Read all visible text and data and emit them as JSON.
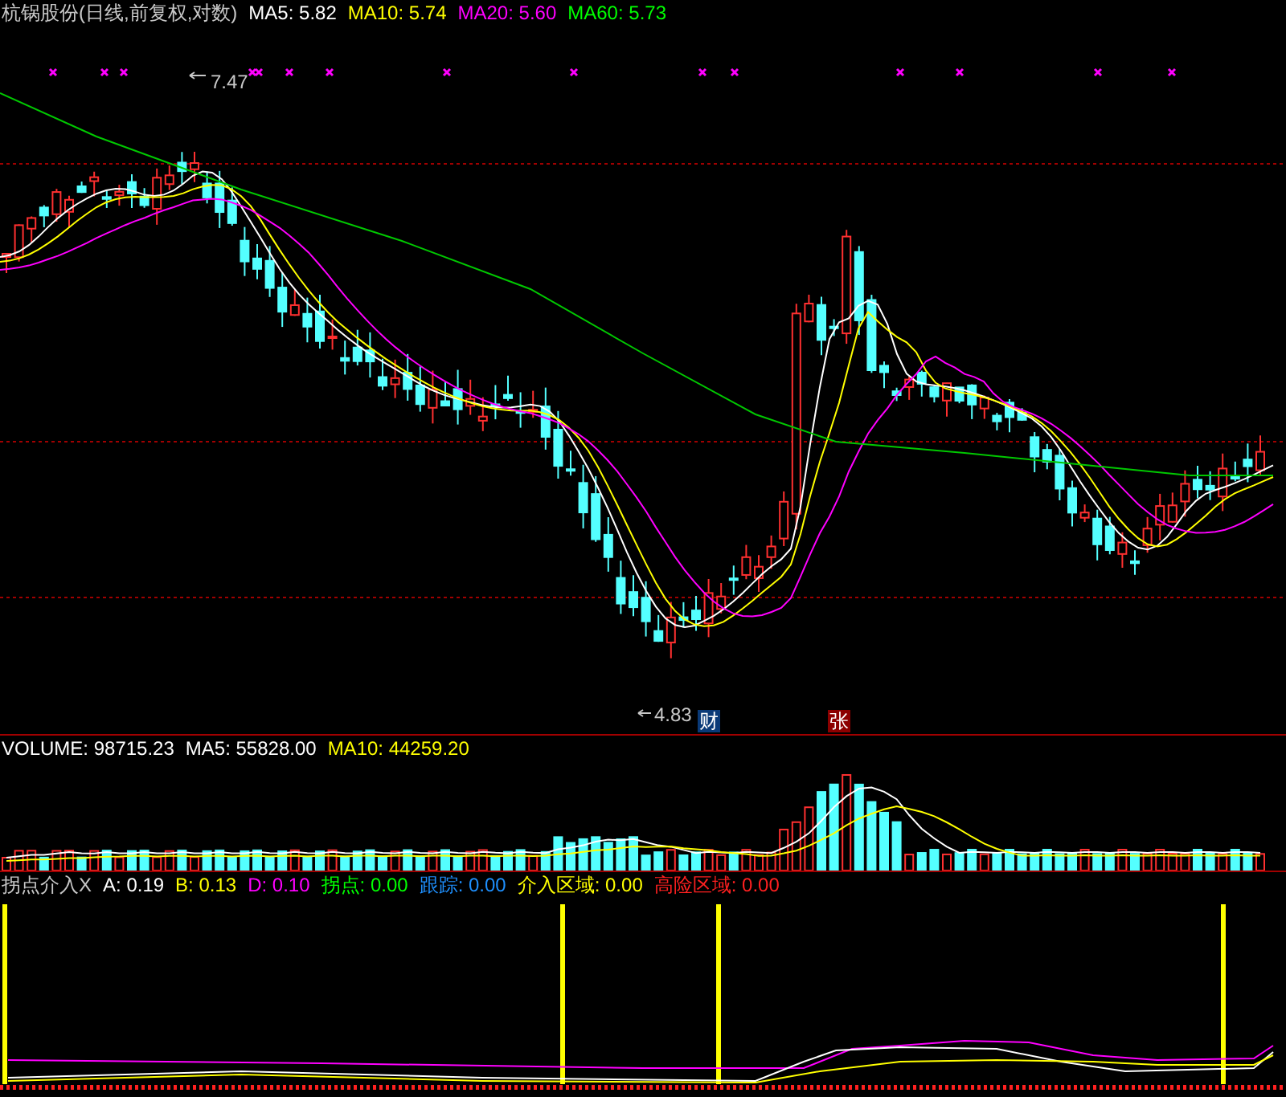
{
  "main_panel": {
    "title": "杭锅股份(日线,前复权,对数)",
    "legend": [
      {
        "text": "MA5: 5.82",
        "color": "#ffffff"
      },
      {
        "text": "MA10: 5.74",
        "color": "#ffff00"
      },
      {
        "text": "MA20: 5.60",
        "color": "#ff00ff"
      },
      {
        "text": "MA60: 5.73",
        "color": "#00ff00"
      }
    ],
    "high_label": "7.47",
    "low_label": "4.83",
    "badges": [
      {
        "text": "财",
        "color": "#0a3a78"
      },
      {
        "text": "张",
        "color": "#8c0000"
      }
    ]
  },
  "volume_panel": {
    "legend": [
      {
        "text": "VOLUME: 98715.23",
        "color": "#ffffff"
      },
      {
        "text": "MA5: 55828.00",
        "color": "#ffffff"
      },
      {
        "text": "MA10: 44259.20",
        "color": "#ffff00"
      }
    ]
  },
  "indicator_panel": {
    "title": "拐点介入X",
    "legend": [
      {
        "text": "A: 0.19",
        "color": "#ffffff"
      },
      {
        "text": "B: 0.13",
        "color": "#ffff00"
      },
      {
        "text": "D: 0.10",
        "color": "#ff00ff"
      },
      {
        "text": "拐点: 0.00",
        "color": "#00ff00"
      },
      {
        "text": "跟踪: 0.00",
        "color": "#1e90ff"
      },
      {
        "text": "介入区域: 0.00",
        "color": "#ffff00"
      },
      {
        "text": "高险区域: 0.00",
        "color": "#ff2020"
      }
    ]
  }
}
